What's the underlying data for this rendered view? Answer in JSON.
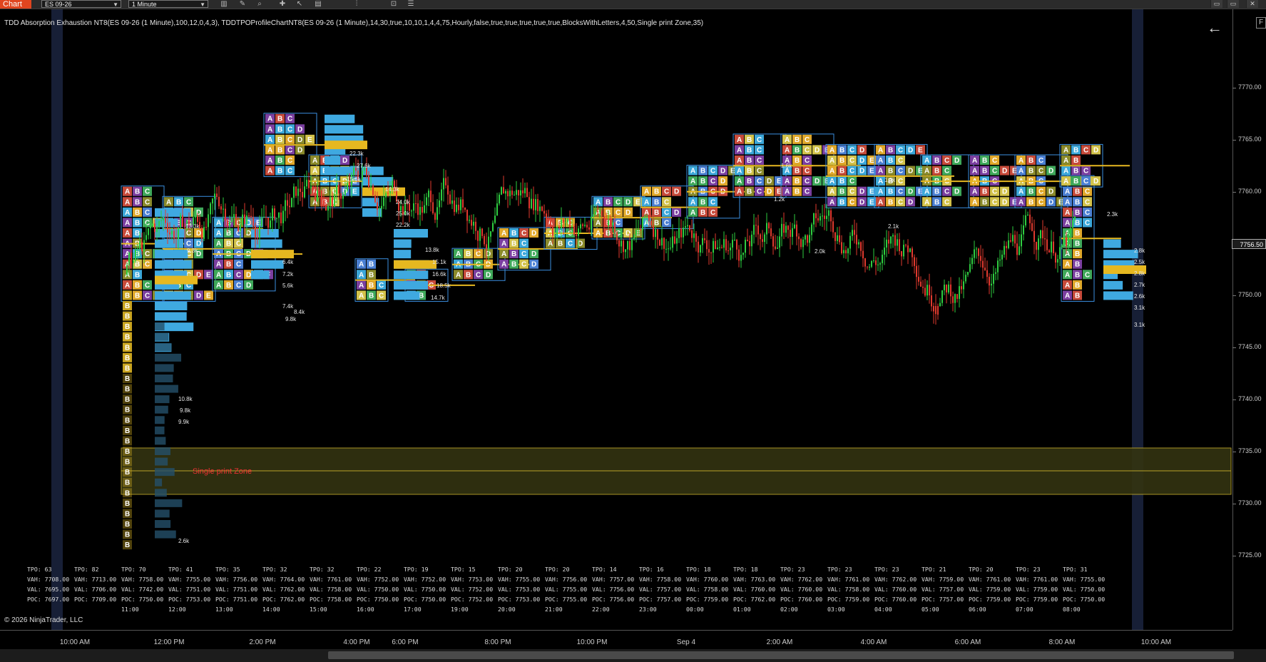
{
  "toolbar": {
    "tab_label": "Chart",
    "instrument": "ES 09-26",
    "interval": "1 Minute",
    "icons": [
      "bar-type-icon",
      "draw-icon",
      "zoom-icon",
      "crosshair-icon",
      "pointer-icon",
      "data-box-icon",
      "indicators-icon",
      "strategies-icon",
      "properties-icon"
    ]
  },
  "window_buttons": [
    "minimize-icon",
    "maximize-icon",
    "close-icon"
  ],
  "indicator_label": "TDD Absorption Exhaustion NT8(ES 09-26 (1 Minute),100,12,0,4,3), TDDTPOProfileChartNT8(ES 09-26 (1 Minute),14,30,true,10,10,1,4,4,75,Hourly,false,true,true,true,true,true,BlocksWithLetters,4,50,Single print Zone,35)",
  "price_axis": {
    "ticks": [
      "7770.00",
      "7765.00",
      "7760.00",
      "7755.00",
      "7750.00",
      "7745.00",
      "7740.00",
      "7735.00",
      "7730.00",
      "7725.00"
    ],
    "current_price": "7756.50",
    "right_label": "F"
  },
  "time_axis": {
    "ticks": [
      "10:00 AM",
      "12:00 PM",
      "2:00 PM",
      "4:00 PM",
      "6:00 PM",
      "8:00 PM",
      "10:00 PM",
      "Sep 4",
      "2:00 AM",
      "4:00 AM",
      "6:00 AM",
      "8:00 AM",
      "10:00 AM"
    ]
  },
  "single_print_zone_label": "Single print Zone",
  "copyright": "© 2026 NinjaTrader, LLC",
  "volume_labels": [
    "22.3k",
    "27.6k",
    "15.6k",
    "14.3k",
    "24.0k",
    "25.0k",
    "22.2k",
    "13.8k",
    "15.1k",
    "16.6k",
    "18.5k",
    "14.7k",
    "13.3k",
    "9.3k",
    "6.4k",
    "7.2k",
    "5.6k",
    "7.4k",
    "8.4k",
    "9.8k",
    "10.8k",
    "9.8k",
    "9.9k",
    "2.6k",
    "2.8k",
    "2.5k",
    "2.8k",
    "2.7k",
    "2.6k",
    "3.1k",
    "3.1k",
    "2.3k",
    "1.6k",
    "1.2k",
    "1.3k",
    "2.1k",
    "2.0k"
  ],
  "profile_stats": [
    {
      "tpo": "TPO: 63",
      "vah": "VAH: 7708.00",
      "val": "VAL: 7695.00",
      "poc": "POC: 7697.00",
      "time": ""
    },
    {
      "tpo": "TPO: 82",
      "vah": "VAH: 7713.00",
      "val": "VAL: 7706.00",
      "poc": "POC: 7709.00",
      "time": ""
    },
    {
      "tpo": "TPO: 70",
      "vah": "VAH: 7758.00",
      "val": "VAL: 7742.00",
      "poc": "POC: 7750.00",
      "time": "11:00"
    },
    {
      "tpo": "TPO: 41",
      "vah": "VAH: 7755.00",
      "val": "VAL: 7751.00",
      "poc": "POC: 7753.00",
      "time": "12:00"
    },
    {
      "tpo": "TPO: 35",
      "vah": "VAH: 7756.00",
      "val": "VAL: 7751.00",
      "poc": "POC: 7751.00",
      "time": "13:00"
    },
    {
      "tpo": "TPO: 32",
      "vah": "VAH: 7764.00",
      "val": "VAL: 7762.00",
      "poc": "POC: 7762.00",
      "time": "14:00"
    },
    {
      "tpo": "TPO: 32",
      "vah": "VAH: 7761.00",
      "val": "VAL: 7758.00",
      "poc": "POC: 7758.00",
      "time": "15:00"
    },
    {
      "tpo": "TPO: 22",
      "vah": "VAH: 7752.00",
      "val": "VAL: 7750.00",
      "poc": "POC: 7750.00",
      "time": "16:00"
    },
    {
      "tpo": "TPO: 19",
      "vah": "VAH: 7752.00",
      "val": "VAL: 7750.00",
      "poc": "POC: 7750.00",
      "time": "17:00"
    },
    {
      "tpo": "TPO: 15",
      "vah": "VAH: 7753.00",
      "val": "VAL: 7752.00",
      "poc": "POC: 7752.00",
      "time": "19:00"
    },
    {
      "tpo": "TPO: 20",
      "vah": "VAH: 7755.00",
      "val": "VAL: 7753.00",
      "poc": "POC: 7753.00",
      "time": "20:00"
    },
    {
      "tpo": "TPO: 20",
      "vah": "VAH: 7756.00",
      "val": "VAL: 7755.00",
      "poc": "POC: 7755.00",
      "time": "21:00"
    },
    {
      "tpo": "TPO: 14",
      "vah": "VAH: 7757.00",
      "val": "VAL: 7756.00",
      "poc": "POC: 7756.00",
      "time": "22:00"
    },
    {
      "tpo": "TPO: 16",
      "vah": "VAH: 7758.00",
      "val": "VAL: 7757.00",
      "poc": "POC: 7757.00",
      "time": "23:00"
    },
    {
      "tpo": "TPO: 18",
      "vah": "VAH: 7760.00",
      "val": "VAL: 7758.00",
      "poc": "POC: 7759.00",
      "time": "00:00"
    },
    {
      "tpo": "TPO: 18",
      "vah": "VAH: 7763.00",
      "val": "VAL: 7760.00",
      "poc": "POC: 7762.00",
      "time": "01:00"
    },
    {
      "tpo": "TPO: 23",
      "vah": "VAH: 7762.00",
      "val": "VAL: 7760.00",
      "poc": "POC: 7760.00",
      "time": "02:00"
    },
    {
      "tpo": "TPO: 23",
      "vah": "VAH: 7761.00",
      "val": "VAL: 7758.00",
      "poc": "POC: 7759.00",
      "time": "03:00"
    },
    {
      "tpo": "TPO: 23",
      "vah": "VAH: 7762.00",
      "val": "VAL: 7760.00",
      "poc": "POC: 7760.00",
      "time": "04:00"
    },
    {
      "tpo": "TPO: 21",
      "vah": "VAH: 7759.00",
      "val": "VAL: 7757.00",
      "poc": "POC: 7757.00",
      "time": "05:00"
    },
    {
      "tpo": "TPO: 20",
      "vah": "VAH: 7761.00",
      "val": "VAL: 7759.00",
      "poc": "POC: 7759.00",
      "time": "06:00"
    },
    {
      "tpo": "TPO: 23",
      "vah": "VAH: 7761.00",
      "val": "VAL: 7759.00",
      "poc": "POC: 7759.00",
      "time": "07:00"
    },
    {
      "tpo": "TPO: 31",
      "vah": "VAH: 7755.00",
      "val": "VAL: 7750.00",
      "poc": "POC: 7750.00",
      "time": "08:00"
    }
  ]
}
